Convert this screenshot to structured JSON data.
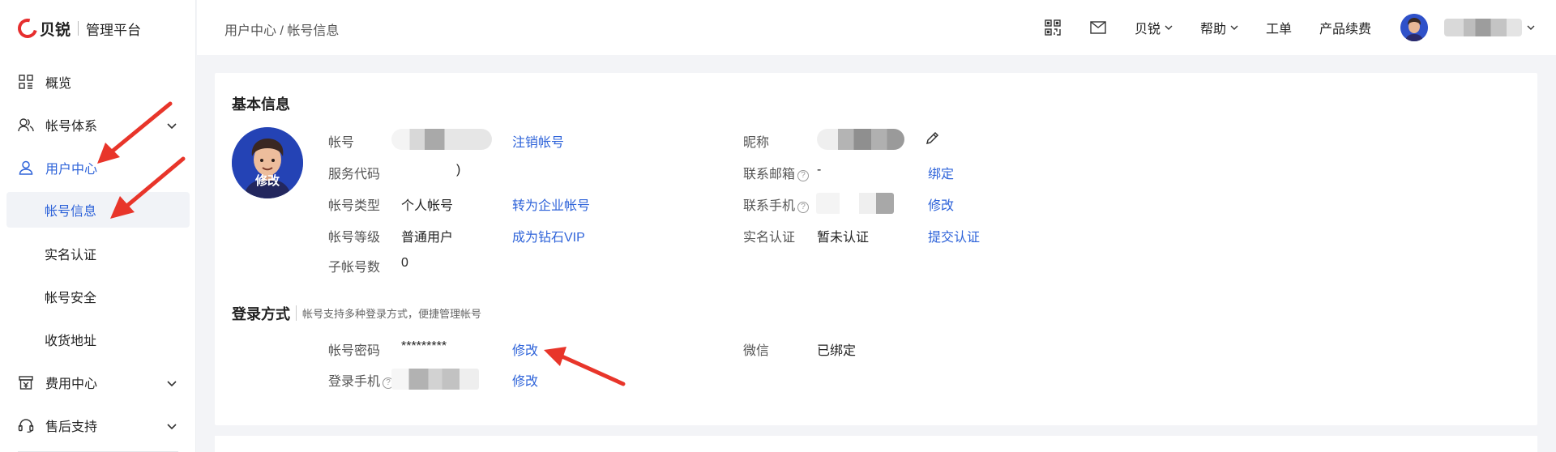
{
  "brand": {
    "name": "贝锐",
    "subtitle": "管理平台",
    "color": "#e62e2e"
  },
  "accent": "#2e63d9",
  "sidebar": {
    "items": [
      {
        "label": "概览",
        "icon": "grid-icon"
      },
      {
        "label": "帐号体系",
        "icon": "users-icon"
      },
      {
        "label": "用户中心",
        "icon": "user-icon"
      },
      {
        "label": "帐号信息"
      },
      {
        "label": "实名认证"
      },
      {
        "label": "帐号安全"
      },
      {
        "label": "收货地址"
      },
      {
        "label": "费用中心",
        "icon": "billing-icon"
      },
      {
        "label": "售后支持",
        "icon": "headset-icon"
      }
    ]
  },
  "header": {
    "breadcrumb": "用户中心 / 帐号信息",
    "links": {
      "brand": "贝锐",
      "help": "帮助",
      "ticket": "工单",
      "renew": "产品续费"
    }
  },
  "basic": {
    "title": "基本信息",
    "avatar_edit": "修改",
    "account": {
      "label": "帐号",
      "action": "注销帐号"
    },
    "service_code": {
      "label": "服务代码",
      "value_tail": ")"
    },
    "account_type": {
      "label": "帐号类型",
      "value": "个人帐号",
      "action": "转为企业帐号"
    },
    "account_level": {
      "label": "帐号等级",
      "value": "普通用户",
      "action": "成为钻石VIP"
    },
    "sub_accounts": {
      "label": "子帐号数",
      "value": "0"
    },
    "nickname": {
      "label": "昵称"
    },
    "email": {
      "label": "联系邮箱",
      "value": "-",
      "action": "绑定"
    },
    "phone": {
      "label": "联系手机",
      "action": "修改"
    },
    "realname": {
      "label": "实名认证",
      "value": "暂未认证",
      "action": "提交认证"
    }
  },
  "login": {
    "title": "登录方式",
    "note": "帐号支持多种登录方式，便捷管理帐号",
    "password": {
      "label": "帐号密码",
      "value": "*********",
      "action": "修改"
    },
    "login_phone": {
      "label": "登录手机",
      "action": "修改"
    },
    "wechat": {
      "label": "微信",
      "value": "已绑定"
    }
  },
  "annotation_color": "#e8352a"
}
